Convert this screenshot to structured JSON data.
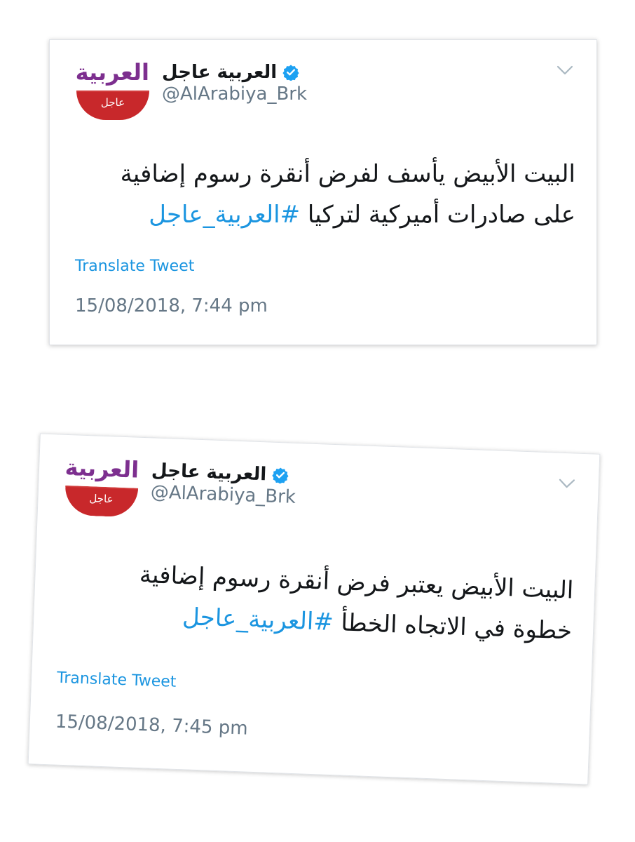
{
  "tweets": [
    {
      "logo": {
        "wordmark": "العربية",
        "band_text": "عاجل"
      },
      "author_name": "العربية عاجل",
      "handle": "@AlArabiya_Brk",
      "text_line1": "البيت الأبيض يأسف لفرض أنقرة رسوم إضافية",
      "text_line2_plain": "على صادرات أميركية لتركيا ",
      "hashtag": "#العربية_عاجل",
      "translate_label": "Translate Tweet",
      "timestamp": "15/08/2018, 7:44 pm",
      "icons": {
        "verified": "verified-badge-icon",
        "menu": "chevron-down-icon"
      }
    },
    {
      "logo": {
        "wordmark": "العربية",
        "band_text": "عاجل"
      },
      "author_name": "العربية عاجل",
      "handle": "@AlArabiya_Brk",
      "text_line1": "البيت الأبيض يعتبر فرض أنقرة رسوم إضافية",
      "text_line2_plain": "خطوة في الاتجاه الخطأ ",
      "hashtag": "#العربية_عاجل",
      "translate_label": "Translate Tweet",
      "timestamp": "15/08/2018, 7:45 pm",
      "icons": {
        "verified": "verified-badge-icon",
        "menu": "chevron-down-icon"
      }
    }
  ],
  "colors": {
    "logo_purple": "#7d2f8f",
    "logo_red": "#c8282b",
    "verified_blue": "#1da1f2",
    "link_blue": "#1b95e0",
    "secondary_gray": "#657786",
    "text_dark": "#14171a"
  }
}
